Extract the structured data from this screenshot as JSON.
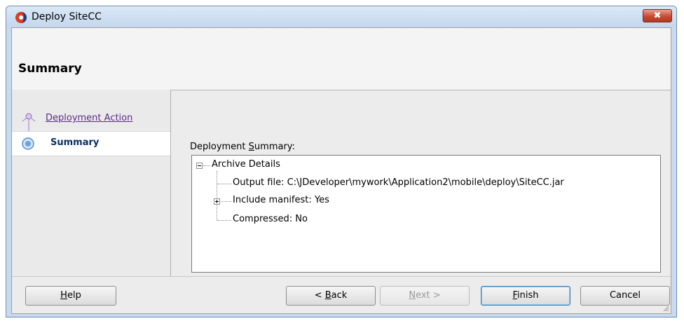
{
  "window": {
    "title": "Deploy SiteCC",
    "close_glyph": "✖"
  },
  "header": {
    "title": "Summary"
  },
  "nav": {
    "steps": [
      {
        "label": "Deployment Action",
        "state": "visited"
      },
      {
        "label": "Summary",
        "state": "current"
      }
    ]
  },
  "content": {
    "summary_label_prefix": "Deployment ",
    "summary_label_mnemonic": "S",
    "summary_label_rest": "ummary:",
    "tree": {
      "root": "Archive Details",
      "children": [
        "Output file: C:\\JDeveloper\\mywork\\Application2\\mobile\\deploy\\SiteCC.jar",
        "Include manifest: Yes",
        "Compressed: No"
      ]
    }
  },
  "buttons": {
    "help": {
      "mnemonic": "H",
      "rest": "elp"
    },
    "back": {
      "prefix": "< ",
      "mnemonic": "B",
      "rest": "ack"
    },
    "next": {
      "mnemonic": "N",
      "rest": "ext >"
    },
    "finish": {
      "mnemonic": "F",
      "rest": "inish"
    },
    "cancel": {
      "label": "Cancel"
    }
  }
}
